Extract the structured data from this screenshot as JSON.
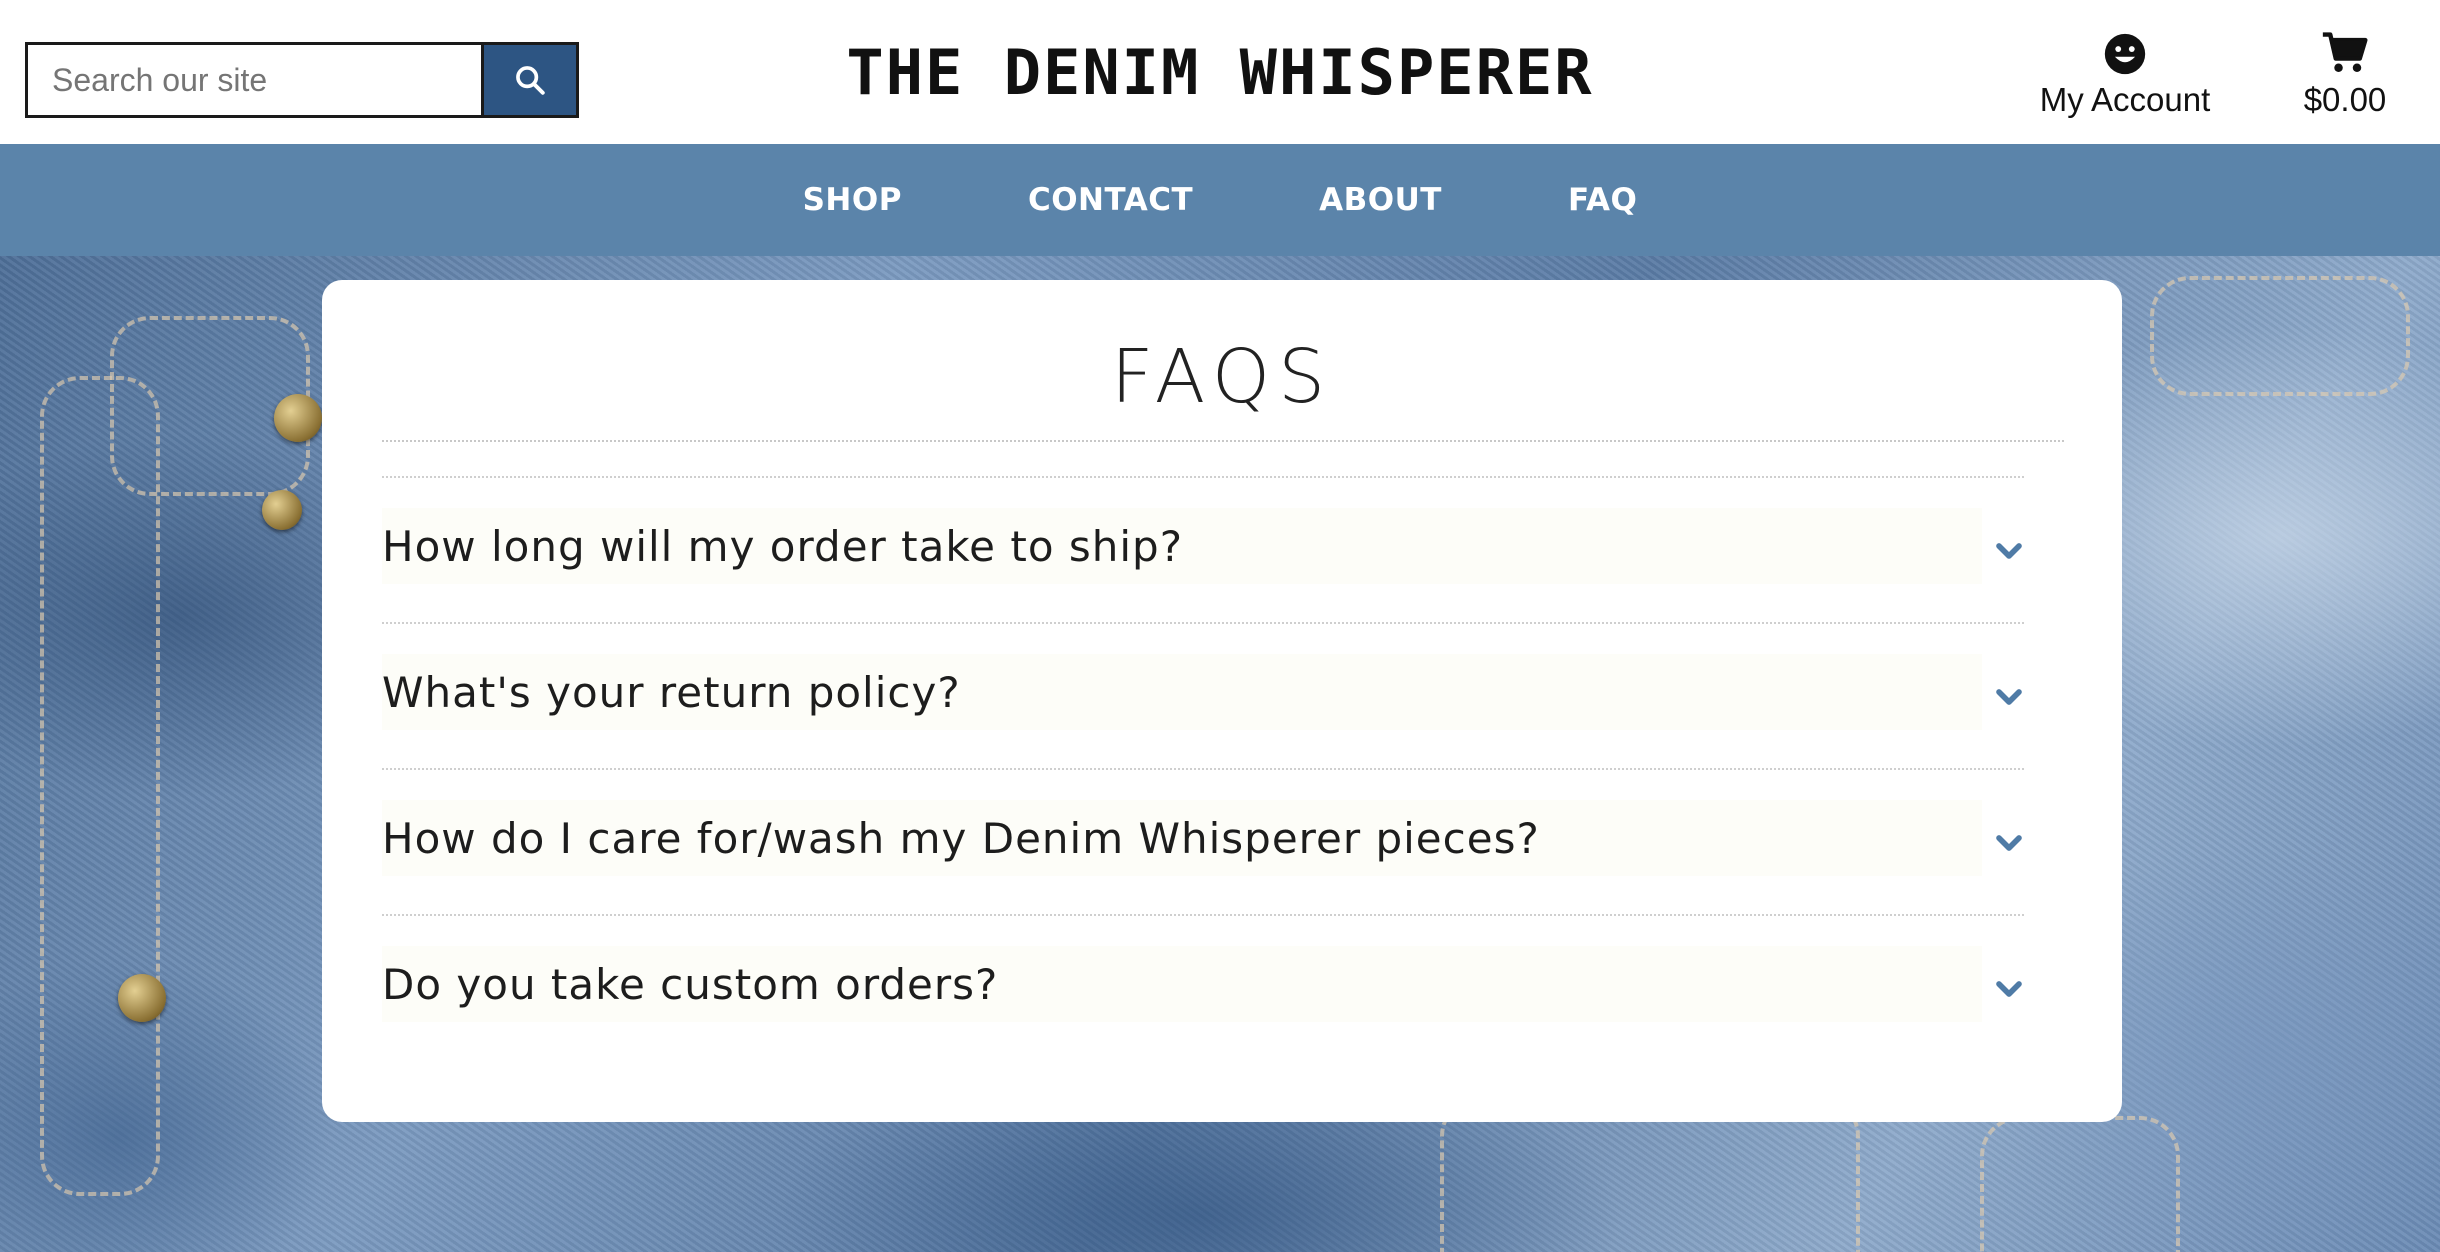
{
  "header": {
    "search": {
      "placeholder": "Search our site",
      "button_icon": "search-icon"
    },
    "brand": "THE DENIM WHISPERER",
    "account": {
      "icon": "smiley-icon",
      "label": "My Account"
    },
    "cart": {
      "icon": "cart-icon",
      "total": "$0.00"
    }
  },
  "nav": {
    "items": [
      {
        "label": "SHOP"
      },
      {
        "label": "CONTACT"
      },
      {
        "label": "ABOUT"
      },
      {
        "label": "FAQ"
      }
    ]
  },
  "faq": {
    "title": "FAQS",
    "items": [
      {
        "question": "How long will my order take to ship?"
      },
      {
        "question": "What's your return policy?"
      },
      {
        "question": "How do I care for/wash my Denim Whisperer pieces?"
      },
      {
        "question": "Do you take custom orders?"
      }
    ],
    "chevron_icon": "chevron-down-icon"
  },
  "colors": {
    "nav_background": "#5b84aa",
    "search_button": "#2d5583",
    "chevron": "#4f7ba6",
    "card_background": "#ffffff"
  }
}
